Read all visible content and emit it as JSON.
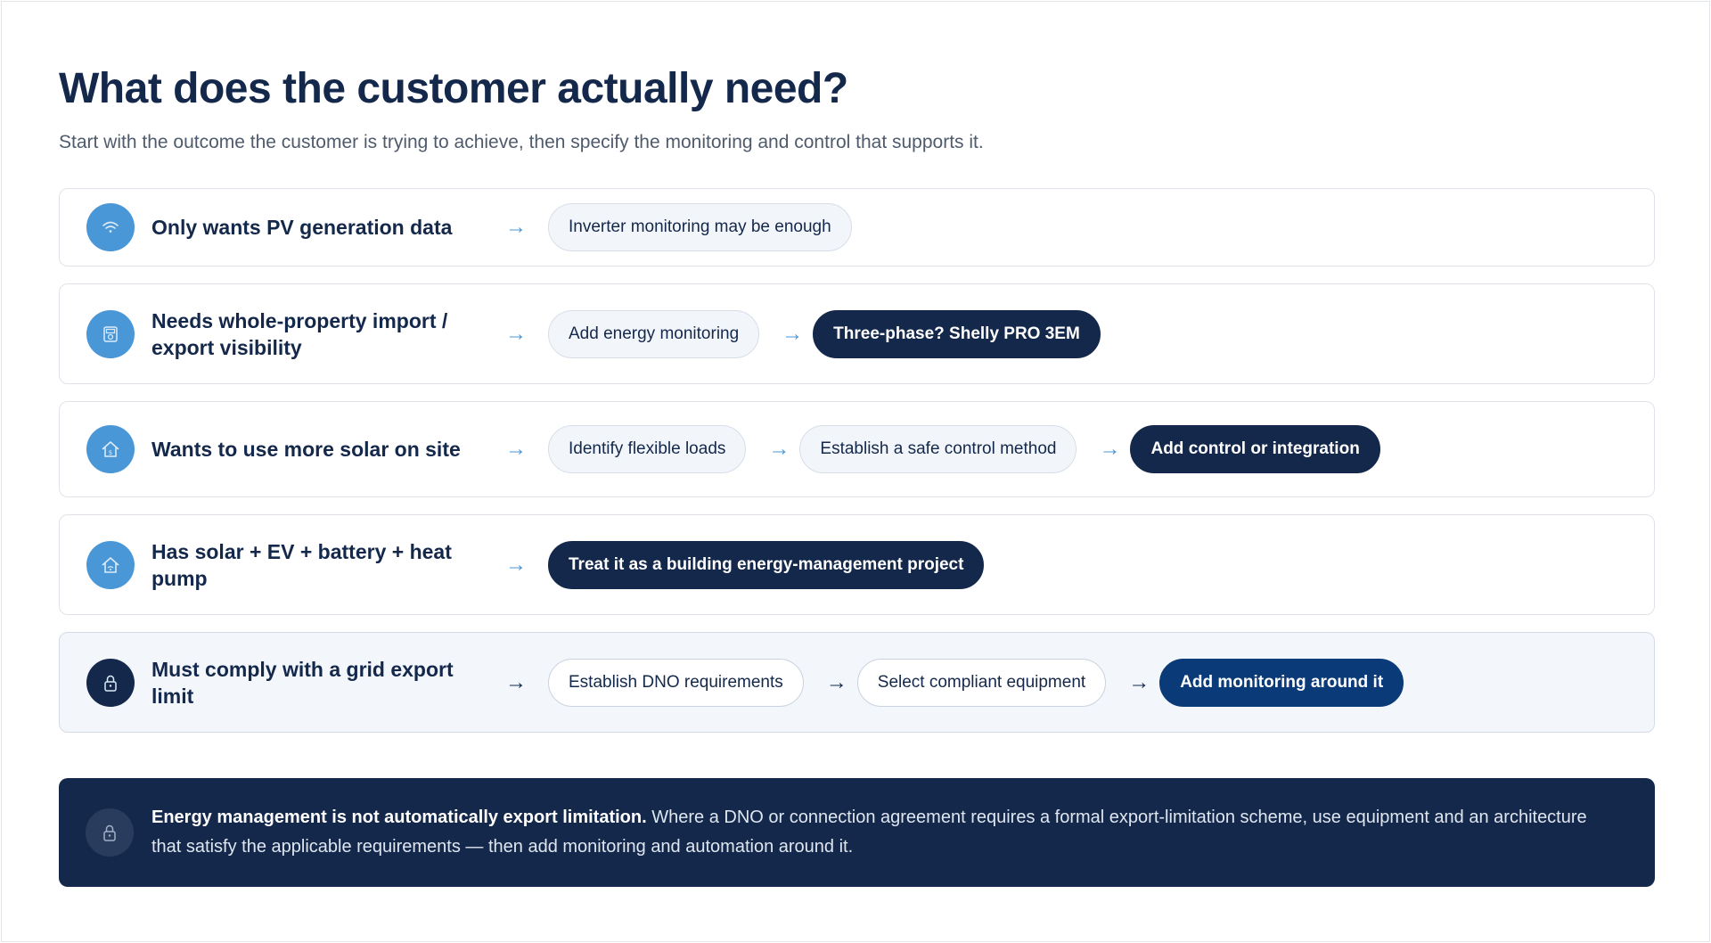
{
  "header": {
    "title": "What does the customer actually need?",
    "subtitle": "Start with the outcome the customer is trying to achieve, then specify the monitoring and control that supports it."
  },
  "rows": [
    {
      "need": "Only wants PV generation data",
      "icon": "signal-icon",
      "steps": [
        "Inverter monitoring may be enough"
      ]
    },
    {
      "need": "Needs whole-property import / export visibility",
      "icon": "meter-icon",
      "steps": [
        "Add energy monitoring",
        "Three-phase? Shelly PRO 3EM"
      ]
    },
    {
      "need": "Wants to use more solar on site",
      "icon": "house-icon",
      "steps": [
        "Identify flexible loads",
        "Establish a safe control method",
        "Add control or integration"
      ]
    },
    {
      "need": "Has solar + EV + battery + heat pump",
      "icon": "smart-home-icon",
      "steps": [
        "Treat it as a building energy-management project"
      ]
    },
    {
      "need": "Must comply with a grid export limit",
      "icon": "lock-icon",
      "steps": [
        "Establish DNO requirements",
        "Select compliant equipment",
        "Add monitoring around it"
      ]
    }
  ],
  "note": {
    "strong": "Energy management is not automatically export limitation.",
    "text": " Where a DNO or connection agreement requires a formal export-limitation scheme, use equipment and an architecture that satisfy the applicable requirements — then add monitoring and automation around it."
  },
  "arrow_glyph": "→",
  "colors": {
    "navy": "#14284b",
    "accent_blue": "#4a97d8",
    "deep_blue": "#0b3a78"
  }
}
